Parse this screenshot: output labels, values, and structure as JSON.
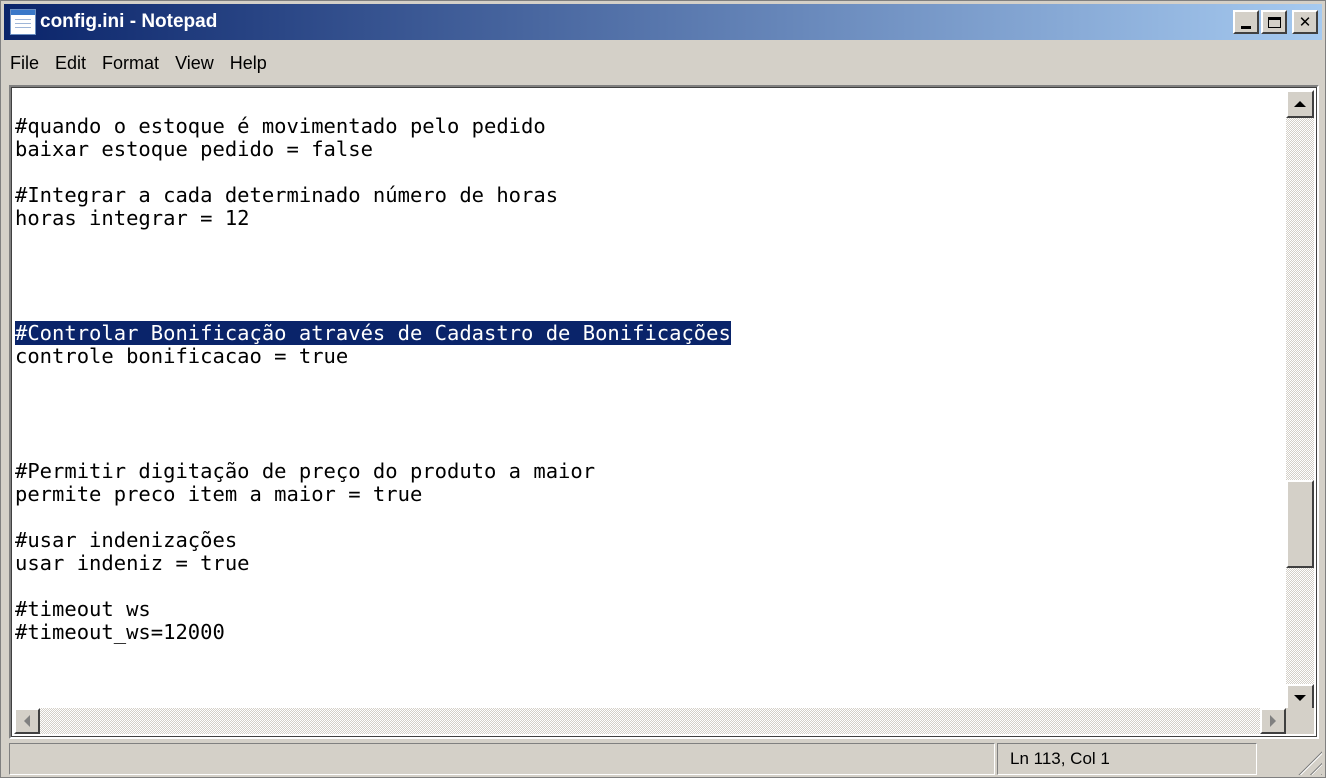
{
  "window": {
    "title": "config.ini - Notepad",
    "app_icon": "notepad-icon"
  },
  "menu": {
    "file": "File",
    "edit": "Edit",
    "format": "Format",
    "view": "View",
    "help": "Help"
  },
  "editor": {
    "lines": [
      "#quando o estoque é movimentado pelo pedido",
      "baixar estoque pedido = false",
      "",
      "#Integrar a cada determinado número de horas",
      "horas integrar = 12",
      "",
      "",
      "",
      "",
      "#Controlar Bonificação através de Cadastro de Bonificações",
      "controle bonificacao = true",
      "",
      "",
      "",
      "",
      "#Permitir digitação de preço do produto a maior",
      "permite preco item a maior = true",
      "",
      "#usar indenizações",
      "usar indeniz = true",
      "",
      "#timeout ws",
      "#timeout_ws=12000"
    ],
    "selected_line_index": 9
  },
  "status": {
    "main": "",
    "position": "Ln 113, Col 1"
  },
  "colors": {
    "title_gradient_start": "#0a246a",
    "title_gradient_end": "#a6caf0",
    "selection_bg": "#0a246a",
    "selection_fg": "#ffffff",
    "chrome": "#d4d0c8"
  }
}
